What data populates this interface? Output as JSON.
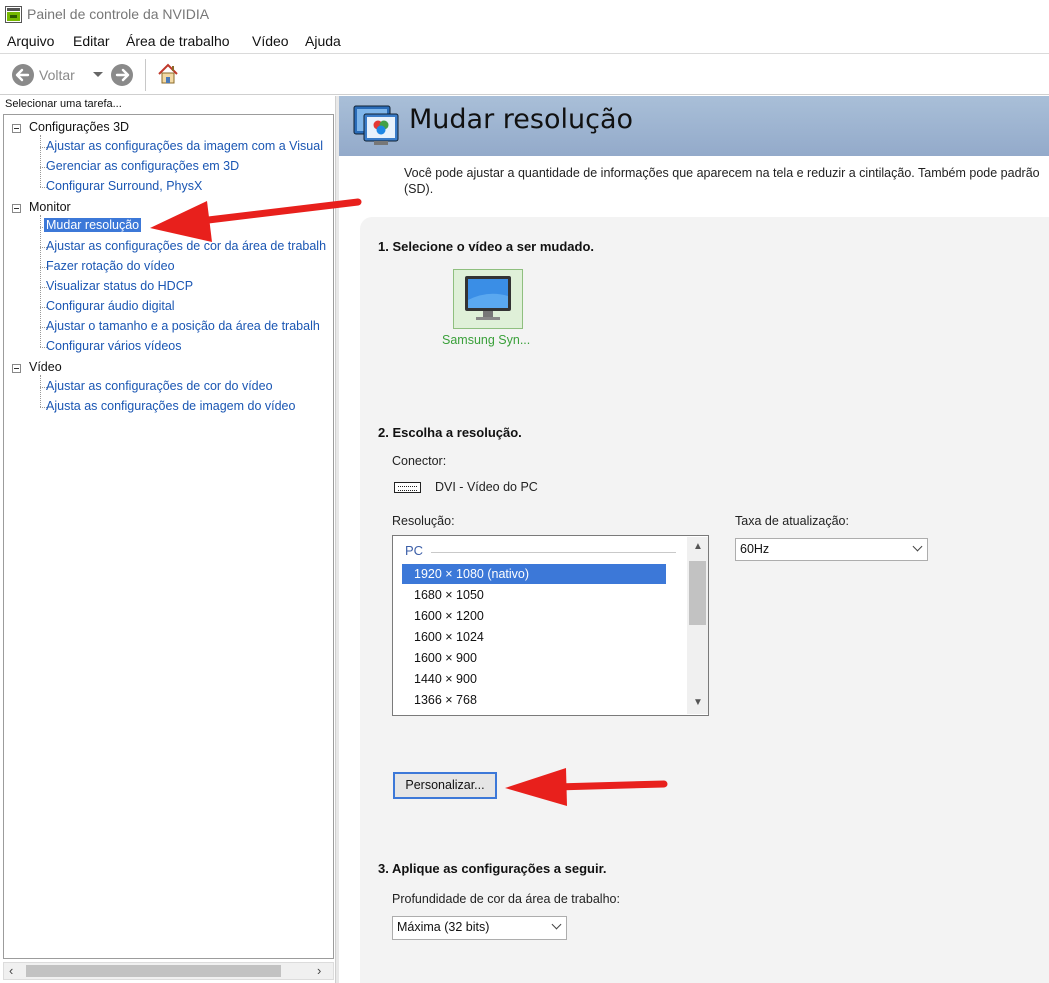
{
  "window": {
    "title": "Painel de controle da NVIDIA"
  },
  "menu": [
    "Arquivo",
    "Editar",
    "Área de trabalho",
    "Vídeo",
    "Ajuda"
  ],
  "toolbar": {
    "back_label": "Voltar"
  },
  "sidebar": {
    "header": "Selecionar uma tarefa...",
    "groups": [
      {
        "label": "Configurações 3D",
        "items": [
          "Ajustar as configurações da imagem com a Visual",
          "Gerenciar as configurações em 3D",
          "Configurar Surround, PhysX"
        ]
      },
      {
        "label": "Monitor",
        "items": [
          "Mudar resolução",
          "Ajustar as configurações de cor da área de trabalh",
          "Fazer rotação do vídeo",
          "Visualizar status do HDCP",
          "Configurar áudio digital",
          "Ajustar o tamanho e a posição da área de trabalh",
          "Configurar vários vídeos"
        ]
      },
      {
        "label": "Vídeo",
        "items": [
          "Ajustar as configurações de cor do vídeo",
          "Ajusta as configurações de imagem do vídeo"
        ]
      }
    ],
    "selected": "Mudar resolução"
  },
  "page": {
    "title": "Mudar resolução",
    "description": "Você pode ajustar a quantidade de informações que aparecem na tela e reduzir  a cintilação. Também pode padrão (SD).",
    "step1": {
      "heading": "1. Selecione o vídeo a ser mudado.",
      "display_name": "Samsung Syn..."
    },
    "step2": {
      "heading": "2. Escolha a resolução.",
      "connector_label": "Conector:",
      "connector_value": "DVI - Vídeo do PC",
      "resolution_label": "Resolução:",
      "resolution_group": "PC",
      "resolutions": [
        "1920 × 1080 (nativo)",
        "1680 × 1050",
        "1600 × 1200",
        "1600 × 1024",
        "1600 × 900",
        "1440 × 900",
        "1366 × 768"
      ],
      "selected_resolution": "1920 × 1080 (nativo)",
      "refresh_label": "Taxa de atualização:",
      "refresh_value": "60Hz",
      "customize_button": "Personalizar..."
    },
    "step3": {
      "heading": "3. Aplique as configurações a seguir.",
      "depth_label": "Profundidade de cor da área de trabalho:",
      "depth_value": "Máxima (32 bits)"
    }
  },
  "annotations": {
    "arrow_color": "#e8201c"
  }
}
